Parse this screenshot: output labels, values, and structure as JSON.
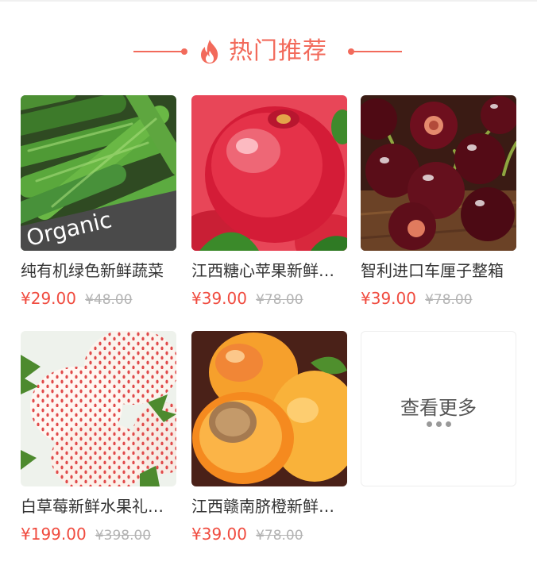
{
  "section": {
    "title": "热门推荐",
    "icon": "flame-icon",
    "accent_color": "#f26a5b"
  },
  "products": [
    {
      "name": "纯有机绿色新鲜蔬菜",
      "price": "¥29.00",
      "original_price": "¥48.00",
      "image": "green-peas"
    },
    {
      "name": "江西糖心苹果新鲜水果",
      "price": "¥39.00",
      "original_price": "¥78.00",
      "image": "red-apple"
    },
    {
      "name": "智利进口车厘子整箱",
      "price": "¥39.00",
      "original_price": "¥78.00",
      "image": "cherries"
    },
    {
      "name": "白草莓新鲜水果礼盒装",
      "price": "¥199.00",
      "original_price": "¥398.00",
      "image": "white-strawberries"
    },
    {
      "name": "江西赣南脐橙新鲜水果",
      "price": "¥39.00",
      "original_price": "¥78.00",
      "image": "apricots"
    }
  ],
  "more": {
    "label": "查看更多",
    "icon": "ellipsis-icon"
  },
  "colors": {
    "price": "#f04b3f",
    "original_price": "#b3b3b3"
  },
  "labels": {
    "organic_text": "Organic"
  }
}
